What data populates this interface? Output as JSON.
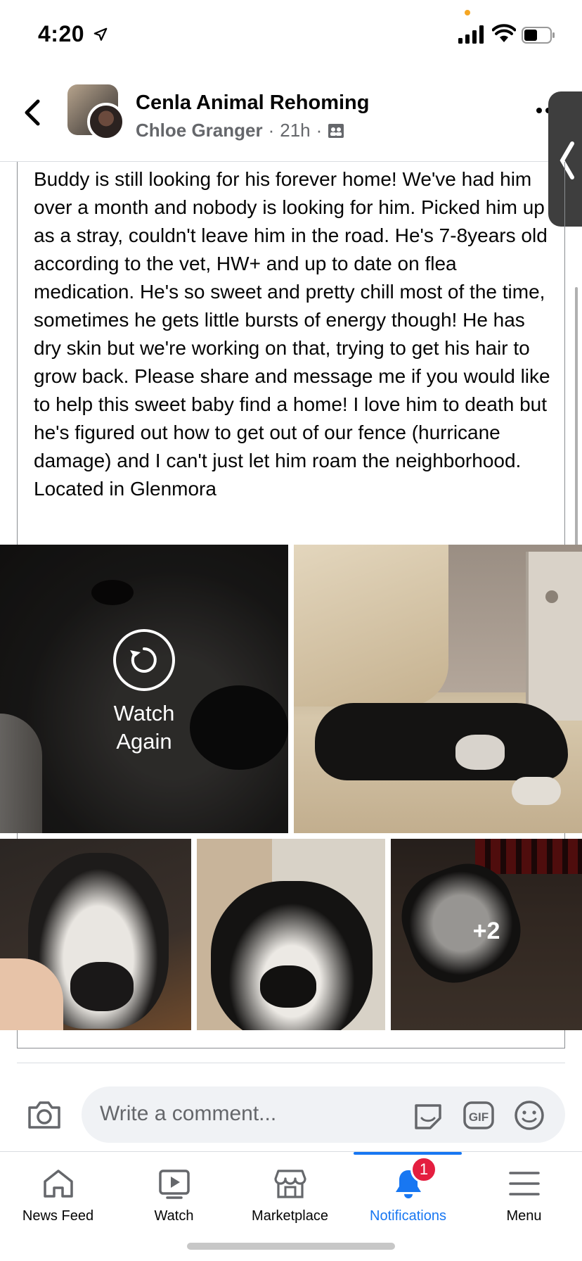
{
  "status_bar": {
    "time": "4:20"
  },
  "header": {
    "group_name": "Cenla Animal Rehoming",
    "author": "Chloe Granger",
    "separator": "·",
    "time_ago": "21h"
  },
  "post": {
    "text": "Buddy is still looking for his forever home! We've had him over a month and nobody is looking for him. Picked him up as a stray, couldn't leave him in the road. He's 7-8years old according to the vet, HW+ and up to date on flea medication. He's so sweet and pretty chill most of the time, sometimes he gets little bursts of energy though! He has dry skin but we're working on that, trying to get his hair to grow back. Please share and message me if you would like to help this sweet baby find a home! I love him to death but he's figured out how to get out of our fence (hurricane damage) and I can't just let him roam the neighborhood. Located in Glenmora"
  },
  "media": {
    "video_overlay_label": "Watch\nAgain",
    "more_count": "+2"
  },
  "comment_bar": {
    "placeholder": "Write a comment...",
    "gif_label": "GIF"
  },
  "bottom_nav": {
    "items": [
      {
        "label": "News Feed",
        "icon": "home-icon"
      },
      {
        "label": "Watch",
        "icon": "watch-icon"
      },
      {
        "label": "Marketplace",
        "icon": "marketplace-icon"
      },
      {
        "label": "Notifications",
        "icon": "bell-icon"
      },
      {
        "label": "Menu",
        "icon": "menu-icon"
      }
    ],
    "active_index": 3,
    "notification_badge": "1"
  },
  "colors": {
    "accent": "#1877f2",
    "badge": "#e41e3f",
    "secondary_text": "#65676b"
  }
}
